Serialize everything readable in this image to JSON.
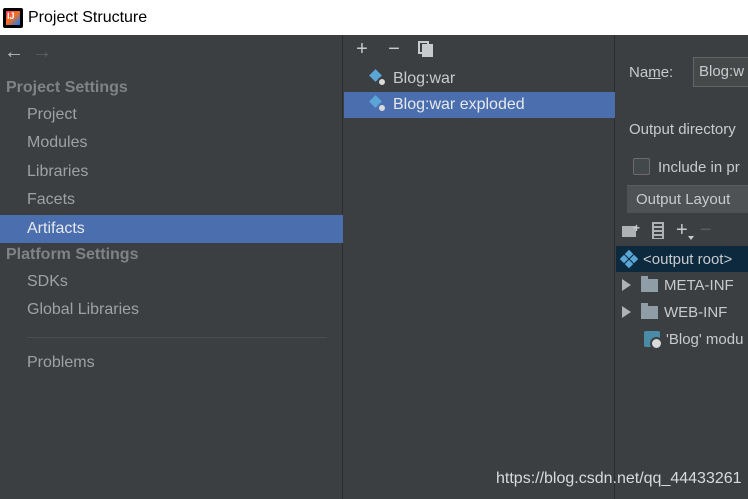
{
  "window": {
    "title": "Project Structure"
  },
  "sidebar": {
    "nav": {
      "back_icon": "arrow-left-icon",
      "forward_icon": "arrow-right-icon"
    },
    "project_settings_header": "Project Settings",
    "project_items": [
      "Project",
      "Modules",
      "Libraries",
      "Facets",
      "Artifacts"
    ],
    "selected_item": "Artifacts",
    "platform_settings_header": "Platform Settings",
    "platform_items": [
      "SDKs",
      "Global Libraries"
    ],
    "problems_label": "Problems"
  },
  "artifacts": {
    "toolbar": {
      "add": "+",
      "remove": "−"
    },
    "items": [
      "Blog:war",
      "Blog:war exploded"
    ],
    "selected_item": "Blog:war exploded"
  },
  "detail": {
    "name_label_pre": "Na",
    "name_label_mnemonic": "m",
    "name_label_post": "e:",
    "name_value": "Blog:w",
    "output_directory_label": "Output directory",
    "include_label": "Include in pr",
    "include_checked": false,
    "output_layout_tab": "Output Layout",
    "layout_toolbar": {
      "add": "+",
      "remove": "−"
    },
    "tree": {
      "root": "<output root>",
      "folders": [
        "META-INF",
        "WEB-INF"
      ],
      "module": "'Blog' modu"
    }
  },
  "watermark": "https://blog.csdn.net/qq_44433261",
  "colors": {
    "selection": "#4b6eaf",
    "background": "#3c3f41",
    "root_selection": "#0d293e"
  }
}
